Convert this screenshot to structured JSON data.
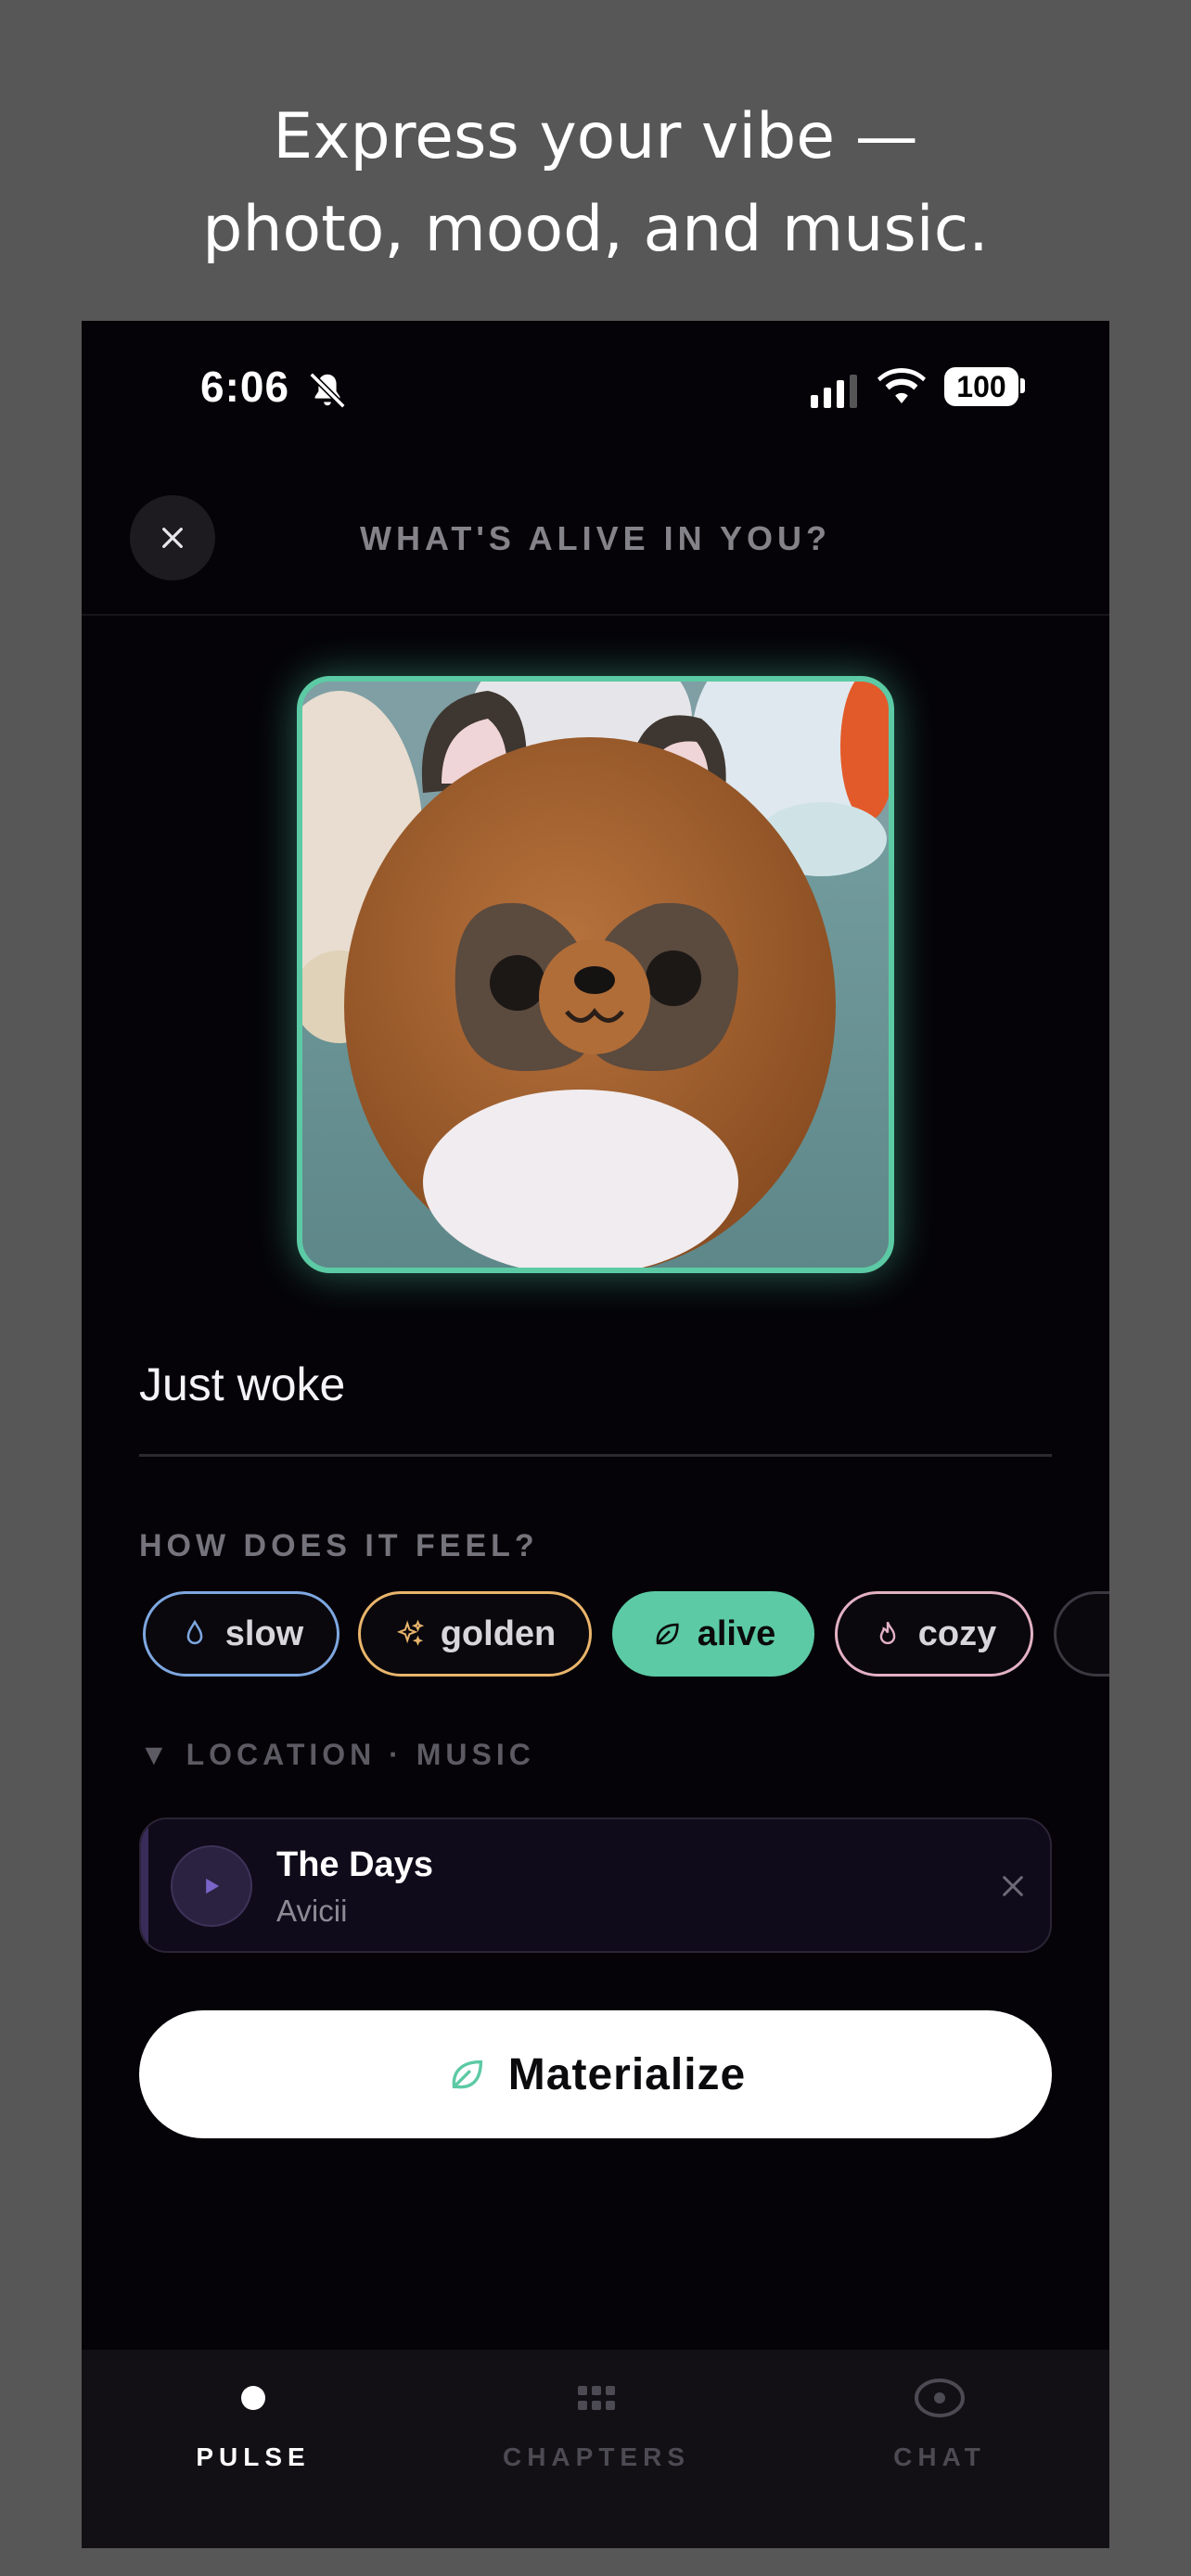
{
  "headline": {
    "line1": "Express your vibe —",
    "line2": "photo, mood, and music."
  },
  "status_bar": {
    "time": "6:06",
    "battery": "100",
    "icons": [
      "bell-slash-icon",
      "cellular-signal-icon",
      "wifi-icon",
      "battery-icon"
    ]
  },
  "header": {
    "title": "WHAT'S ALIVE IN YOU?",
    "close_icon": "close-icon"
  },
  "photo": {
    "description_icon": "photo-plush-raccoon",
    "frame_color": "#5ccaa4"
  },
  "mood_input": {
    "value": "Just woke"
  },
  "feel": {
    "label": "HOW DOES IT FEEL?",
    "chips": [
      {
        "label": "slow",
        "icon": "droplet-icon",
        "color": "#7ea7e0",
        "selected": false
      },
      {
        "label": "golden",
        "icon": "sparkles-icon",
        "color": "#e9b56c",
        "selected": false
      },
      {
        "label": "alive",
        "icon": "leaf-icon",
        "color": "#5ccaa4",
        "selected": true
      },
      {
        "label": "cozy",
        "icon": "flame-icon",
        "color": "#e3b1c3",
        "selected": false
      }
    ]
  },
  "location_toggle": {
    "label": "▼ LOCATION · MUSIC"
  },
  "music": {
    "title": "The Days",
    "artist": "Avicii",
    "play_icon": "play-icon",
    "remove_icon": "close-icon"
  },
  "materialize": {
    "label": "Materialize",
    "icon": "leaf-icon"
  },
  "tabs": [
    {
      "label": "PULSE",
      "icon": "dot-icon",
      "active": true
    },
    {
      "label": "CHAPTERS",
      "icon": "grid-icon",
      "active": false
    },
    {
      "label": "CHAT",
      "icon": "chat-eye-icon",
      "active": false
    }
  ],
  "colors": {
    "background": "#575757",
    "phone_bg": "#050307",
    "accent_green": "#5ccaa4"
  }
}
